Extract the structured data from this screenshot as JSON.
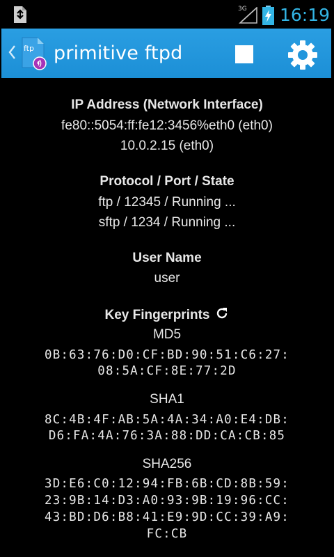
{
  "status_bar": {
    "time": "16:19",
    "network_label": "3G",
    "left_icon": "download-notification-icon",
    "battery_icon": "battery-charging-icon",
    "signal_icon": "signal-icon"
  },
  "action_bar": {
    "title": "primitive ftpd",
    "logo_text": "ftp",
    "back_icon": "chevron-left-icon",
    "stop_icon": "stop-icon",
    "settings_icon": "gear-icon",
    "color": "#2196dc"
  },
  "ip_section": {
    "heading": "IP Address (Network Interface)",
    "lines": [
      "fe80::5054:ff:fe12:3456%eth0 (eth0)",
      "10.0.2.15 (eth0)"
    ]
  },
  "protocol_section": {
    "heading": "Protocol / Port / State",
    "lines": [
      "ftp / 12345 / Running ...",
      "sftp / 1234 / Running ..."
    ]
  },
  "user_section": {
    "heading": "User Name",
    "value": "user"
  },
  "fingerprints": {
    "heading": "Key Fingerprints",
    "refresh_icon": "refresh-icon",
    "md5": {
      "label": "MD5",
      "lines": [
        "0B:63:76:D0:CF:BD:90:51:C6:27:",
        "08:5A:CF:8E:77:2D"
      ]
    },
    "sha1": {
      "label": "SHA1",
      "lines": [
        "8C:4B:4F:AB:5A:4A:34:A0:E4:DB:",
        "D6:FA:4A:76:3A:88:DD:CA:CB:85"
      ]
    },
    "sha256": {
      "label": "SHA256",
      "lines": [
        "3D:E6:C0:12:94:FB:6B:CD:8B:59:",
        "23:9B:14:D3:A0:93:9B:19:96:CC:",
        "43:BD:D6:B8:41:E9:9D:CC:39:A9:",
        "FC:CB"
      ]
    }
  }
}
